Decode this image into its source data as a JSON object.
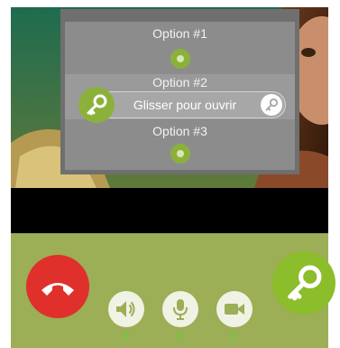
{
  "colors": {
    "accent_green": "#8cb13a",
    "hangup_red": "#e0302b",
    "control_bar": "#9cae56",
    "popup_bg": "#8c8c8c"
  },
  "options_menu": {
    "options": [
      {
        "label": "Option #1",
        "icon": "radio-dot-icon"
      },
      {
        "label": "Option #2",
        "icon": "radio-dot-icon"
      },
      {
        "label": "Option #3",
        "icon": "radio-dot-icon"
      }
    ],
    "slider": {
      "label": "Glisser pour ouvrir",
      "start_icon": "key-icon",
      "end_icon": "key-icon"
    }
  },
  "call_controls": {
    "hangup": {
      "icon": "phone-hangup-icon"
    },
    "speaker": {
      "icon": "speaker-icon"
    },
    "microphone": {
      "icon": "microphone-icon"
    },
    "camera": {
      "icon": "video-camera-icon"
    },
    "unlock": {
      "icon": "key-icon"
    }
  }
}
